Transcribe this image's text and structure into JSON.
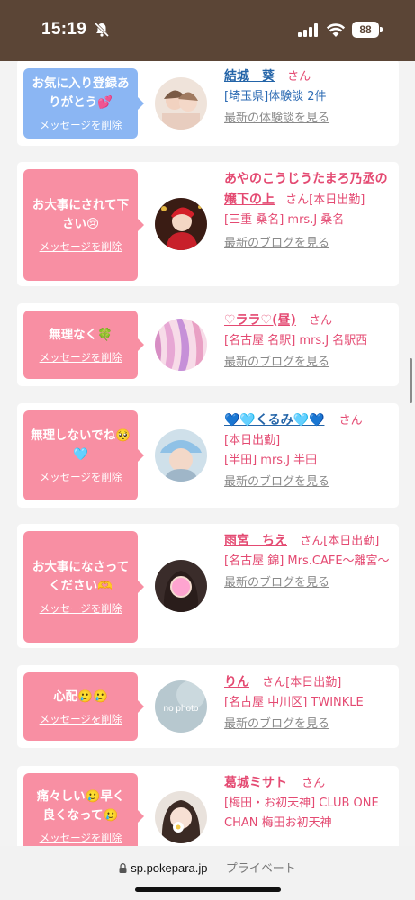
{
  "status_bar": {
    "time": "15:19",
    "battery": "88"
  },
  "items": [
    {
      "bubble_color": "blue",
      "message": "お気に入り登録ありがとう💕",
      "delete_label": "メッセージを削除",
      "name": "結城　葵",
      "name_color": "blue",
      "suffix": "さん",
      "shop": "[埼玉県]体験談 2件",
      "shop_color": "blue",
      "more": "最新の体験談を見る",
      "avatar_icon": "avatar-photo"
    },
    {
      "bubble_color": "pink",
      "message": "お大事にされて下さい😢",
      "delete_label": "メッセージを削除",
      "name": "あやのこうじうたまろ乃丞の嬢下の上",
      "suffix": "さん[本日出勤]",
      "shop": "[三重 桑名] mrs.J 桑名",
      "more": "最新のブログを見る",
      "avatar_icon": "avatar-photo"
    },
    {
      "bubble_color": "pink",
      "message": "無理なく🍀",
      "delete_label": "メッセージを削除",
      "name": "♡ララ♡(昼)",
      "suffix": "さん",
      "shop": "[名古屋 名駅] mrs.J 名駅西",
      "more": "最新のブログを見る",
      "avatar_icon": "avatar-photo"
    },
    {
      "bubble_color": "pink",
      "message": "無理しないでね🥺🩵",
      "delete_label": "メッセージを削除",
      "name": "💙🩵くるみ🩵💙",
      "suffix": "さん",
      "status": "[本日出勤]",
      "shop": "[半田] mrs.J 半田",
      "more": "最新のブログを見る",
      "avatar_icon": "avatar-photo"
    },
    {
      "bubble_color": "pink",
      "message": "お大事になさってください🫶",
      "delete_label": "メッセージを削除",
      "name": "雨宮　ちえ",
      "suffix": "さん[本日出勤]",
      "shop": "[名古屋 錦] Mrs.CAFE～離宮～",
      "more": "最新のブログを見る",
      "avatar_icon": "avatar-photo"
    },
    {
      "bubble_color": "pink",
      "message": "心配🥲🥲",
      "delete_label": "メッセージを削除",
      "name": "りん",
      "suffix": "さん[本日出勤]",
      "shop": "[名古屋 中川区] TWINKLE",
      "more": "最新のブログを見る",
      "avatar_icon": "no-photo",
      "avatar_text": "no photo"
    },
    {
      "bubble_color": "pink",
      "message": "痛々しい🥲早く良くなって🥲",
      "delete_label": "メッセージを削除",
      "name": "葛城ミサト",
      "suffix": "さん",
      "shop": "[梅田・お初天神] CLUB ONE CHAN 梅田お初天神",
      "more": "",
      "avatar_icon": "avatar-photo"
    }
  ],
  "url_bar": {
    "domain": "sp.pokepara.jp",
    "separator": " — ",
    "private_label": "プライベート"
  }
}
